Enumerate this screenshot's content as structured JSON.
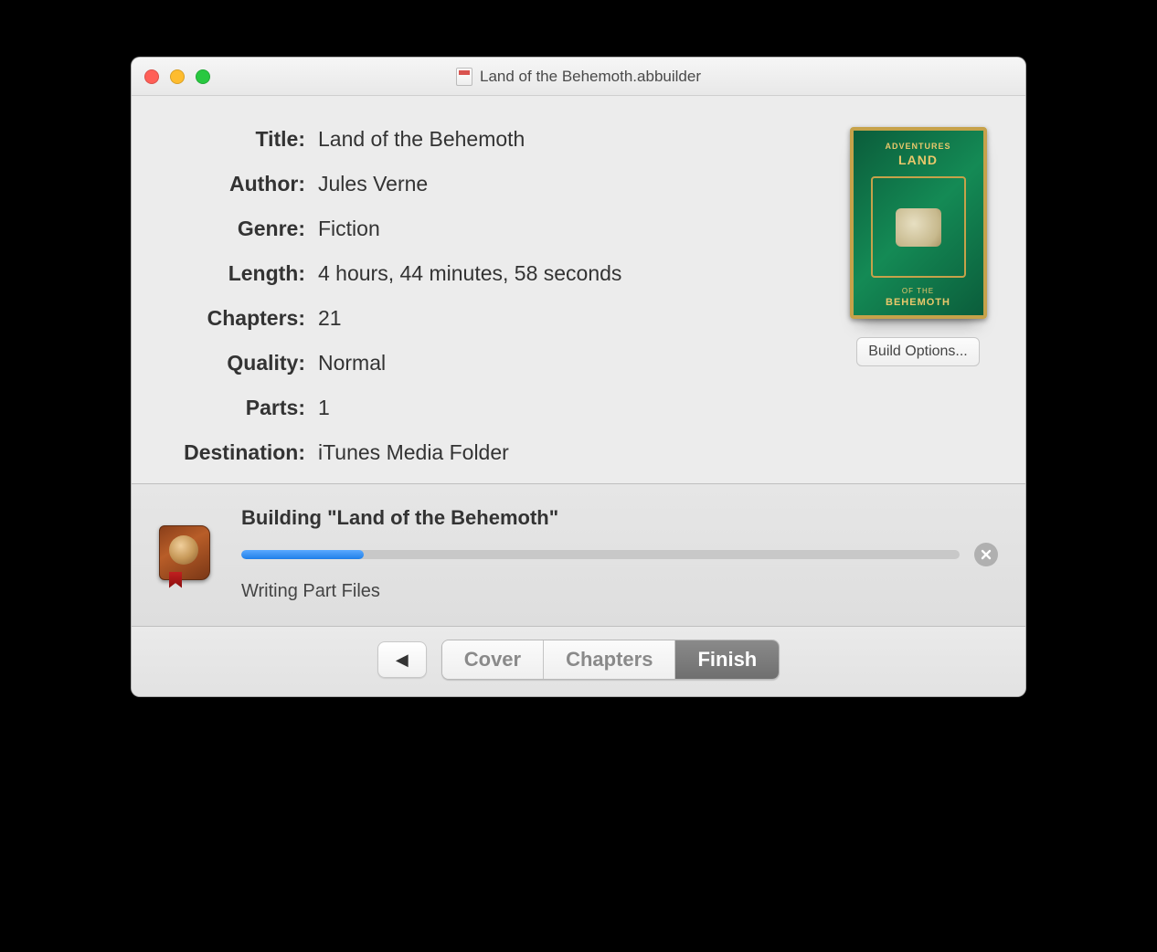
{
  "window": {
    "title": "Land of the Behemoth.abbuilder"
  },
  "metadata": {
    "labels": {
      "title": "Title:",
      "author": "Author:",
      "genre": "Genre:",
      "length": "Length:",
      "chapters": "Chapters:",
      "quality": "Quality:",
      "parts": "Parts:",
      "destination": "Destination:"
    },
    "values": {
      "title": "Land of the Behemoth",
      "author": "Jules Verne",
      "genre": "Fiction",
      "length": "4 hours, 44 minutes, 58 seconds",
      "chapters": "21",
      "quality": "Normal",
      "parts": "1",
      "destination": "iTunes Media Folder"
    }
  },
  "cover": {
    "line1": "ADVENTURES",
    "line2": "LAND",
    "line3": "OF THE",
    "line4": "BEHEMOTH"
  },
  "sidebar": {
    "build_options_label": "Build Options..."
  },
  "progress": {
    "title": "Building \"Land of the Behemoth\"",
    "status": "Writing Part Files",
    "percent": 17
  },
  "footer": {
    "back_symbol": "◀",
    "tabs": {
      "cover": "Cover",
      "chapters": "Chapters",
      "finish": "Finish"
    },
    "active_tab": "finish"
  }
}
